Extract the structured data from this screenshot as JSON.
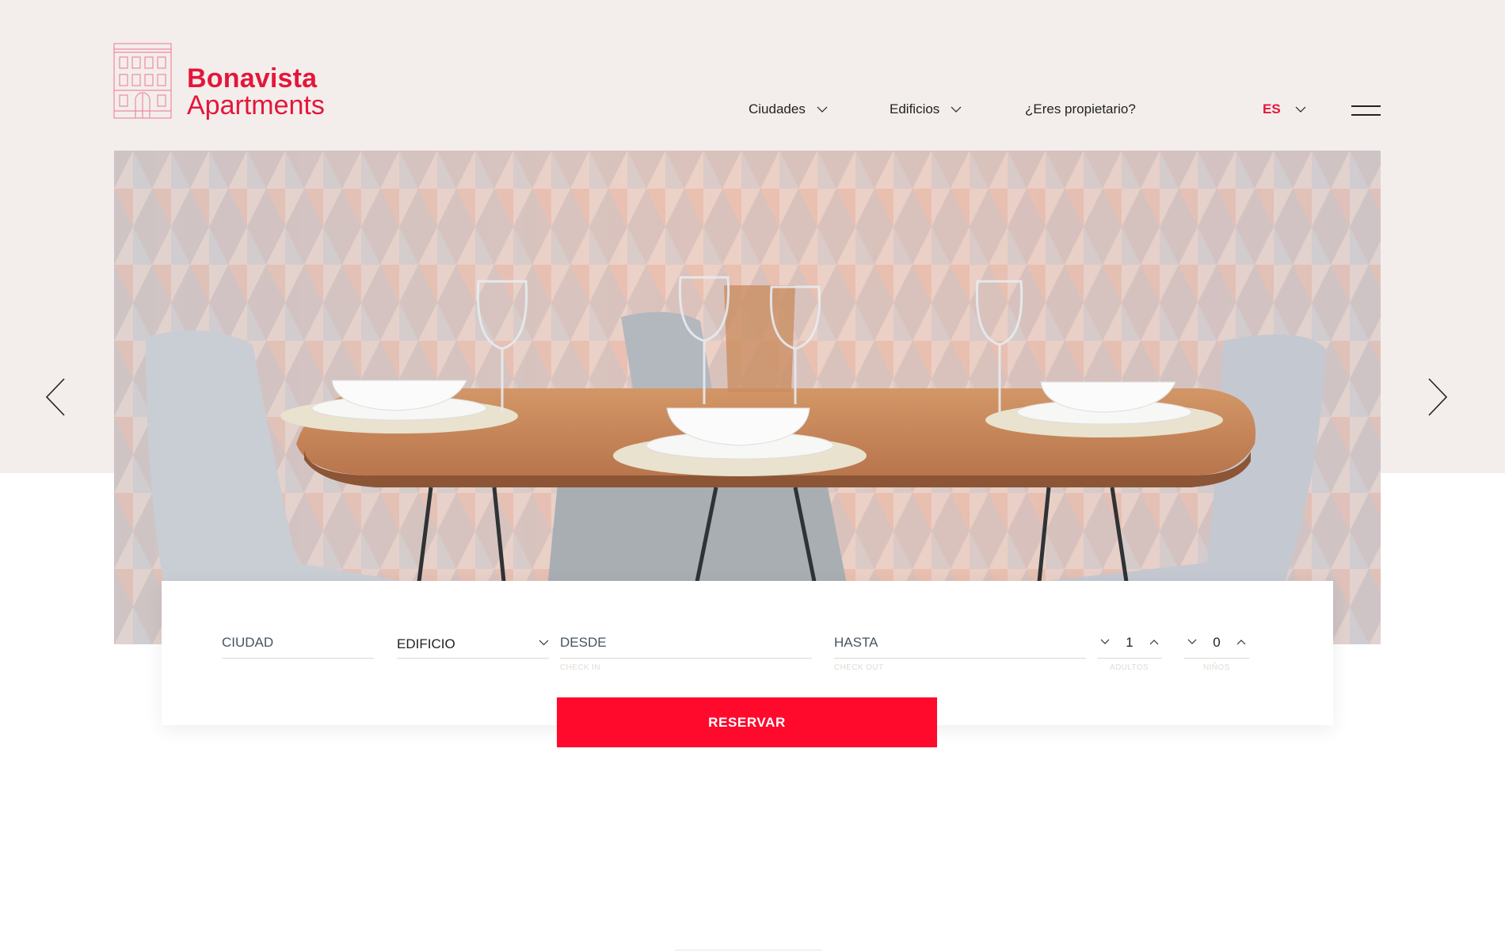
{
  "brand": {
    "line1": "Bonavista",
    "line2": "Apartments",
    "color": "#e4163a"
  },
  "nav": {
    "items": [
      {
        "label": "Ciudades",
        "has_dropdown": true
      },
      {
        "label": "Edificios",
        "has_dropdown": true
      },
      {
        "label": "¿Eres propietario?",
        "has_dropdown": false
      }
    ],
    "language": "ES",
    "menu_icon": "hamburger-icon"
  },
  "hero": {
    "image": "dining-table-with-place-settings-and-chairs",
    "prev_icon": "chevron-left-icon",
    "next_icon": "chevron-right-icon"
  },
  "booking": {
    "city": {
      "placeholder": "CIUDAD"
    },
    "building": {
      "value": "EDIFICIO"
    },
    "from": {
      "placeholder": "DESDE",
      "hint": "CHECK IN"
    },
    "to": {
      "placeholder": "HASTA",
      "hint": "CHECK OUT"
    },
    "adults": {
      "value": "1",
      "hint": "ADULTOS"
    },
    "children": {
      "value": "0",
      "hint": "NIÑOS"
    },
    "submit": "RESERVAR"
  },
  "colors": {
    "accent": "#ff0a2d",
    "band": "#f3eeeb"
  }
}
